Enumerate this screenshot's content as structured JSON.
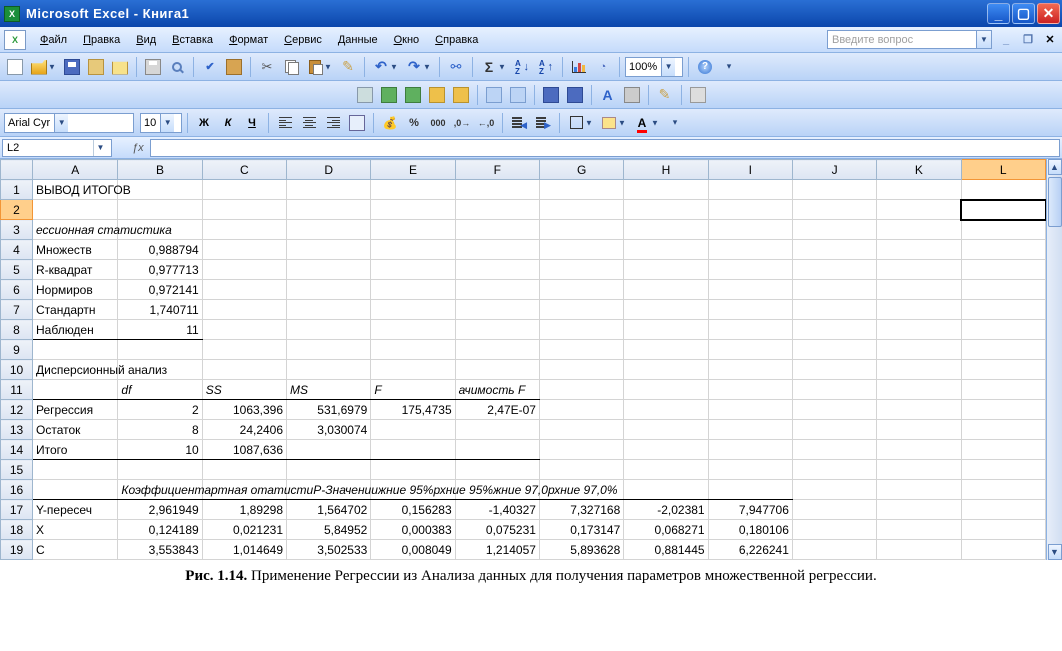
{
  "title": "Microsoft Excel - Книга1",
  "menu": [
    "Файл",
    "Правка",
    "Вид",
    "Вставка",
    "Формат",
    "Сервис",
    "Данные",
    "Окно",
    "Справка"
  ],
  "help_placeholder": "Введите вопрос",
  "formatting": {
    "font_name": "Arial Cyr",
    "font_size": "10",
    "bold": "Ж",
    "italic": "К",
    "underline": "Ч",
    "zoom": "100%"
  },
  "namebox": "L2",
  "formula": "",
  "columns": [
    "A",
    "B",
    "C",
    "D",
    "E",
    "F",
    "G",
    "H",
    "I",
    "J",
    "K",
    "L"
  ],
  "active_col": "L",
  "active_row": "2",
  "rows": [
    {
      "r": "1",
      "cells": {
        "A": "ВЫВОД ИТОГОВ"
      }
    },
    {
      "r": "2",
      "cells": {},
      "active": true
    },
    {
      "r": "3",
      "cells": {
        "A": "ессионная статистика"
      },
      "ital": [
        "A"
      ]
    },
    {
      "r": "4",
      "cells": {
        "A": "Множеств",
        "B": "0,988794"
      }
    },
    {
      "r": "5",
      "cells": {
        "A": "R-квадрат",
        "B": "0,977713"
      }
    },
    {
      "r": "6",
      "cells": {
        "A": "Нормиров",
        "B": "0,972141"
      }
    },
    {
      "r": "7",
      "cells": {
        "A": "Стандартн",
        "B": "1,740711"
      }
    },
    {
      "r": "8",
      "cells": {
        "A": "Наблюден",
        "B": "11"
      },
      "bbot": [
        "A",
        "B"
      ]
    },
    {
      "r": "9",
      "cells": {}
    },
    {
      "r": "10",
      "cells": {
        "A": "Дисперсионный анализ"
      }
    },
    {
      "r": "11",
      "cells": {
        "B": "df",
        "C": "SS",
        "D": "MS",
        "E": "F",
        "F": "ачимость F"
      },
      "ital": [
        "B",
        "C",
        "D",
        "E",
        "F"
      ],
      "bbot": [
        "A",
        "B",
        "C",
        "D",
        "E",
        "F"
      ]
    },
    {
      "r": "12",
      "cells": {
        "A": "Регрессия",
        "B": "2",
        "C": "1063,396",
        "D": "531,6979",
        "E": "175,4735",
        "F": "2,47E-07"
      }
    },
    {
      "r": "13",
      "cells": {
        "A": "Остаток",
        "B": "8",
        "C": "24,2406",
        "D": "3,030074"
      }
    },
    {
      "r": "14",
      "cells": {
        "A": "Итого",
        "B": "10",
        "C": "1087,636"
      },
      "bbot": [
        "A",
        "B",
        "C",
        "D",
        "E",
        "F"
      ]
    },
    {
      "r": "15",
      "cells": {}
    },
    {
      "r": "16",
      "cells": {
        "B": "Коэффициентартная отатистиP-Значениижние 95%рхние 95%жние 97,0рхние 97,0%"
      },
      "ital": [
        "B"
      ],
      "bbot": [
        "A",
        "B",
        "C",
        "D",
        "E",
        "F",
        "G",
        "H",
        "I"
      ]
    },
    {
      "r": "17",
      "cells": {
        "A": "Y-пересеч",
        "B": "2,961949",
        "C": "1,89298",
        "D": "1,564702",
        "E": "0,156283",
        "F": "-1,40327",
        "G": "7,327168",
        "H": "-2,02381",
        "I": "7,947706"
      }
    },
    {
      "r": "18",
      "cells": {
        "A": "X",
        "B": "0,124189",
        "C": "0,021231",
        "D": "5,84952",
        "E": "0,000383",
        "F": "0,075231",
        "G": "0,173147",
        "H": "0,068271",
        "I": "0,180106"
      }
    },
    {
      "r": "19",
      "cells": {
        "A": "C",
        "B": "3,553843",
        "C": "1,014649",
        "D": "3,502533",
        "E": "0,008049",
        "F": "1,214057",
        "G": "5,893628",
        "H": "0,881445",
        "I": "6,226241"
      }
    }
  ],
  "caption_bold": "Рис. 1.14.",
  "caption_text": " Применение Регрессии из Анализа данных для получения параметров множественной регрессии."
}
